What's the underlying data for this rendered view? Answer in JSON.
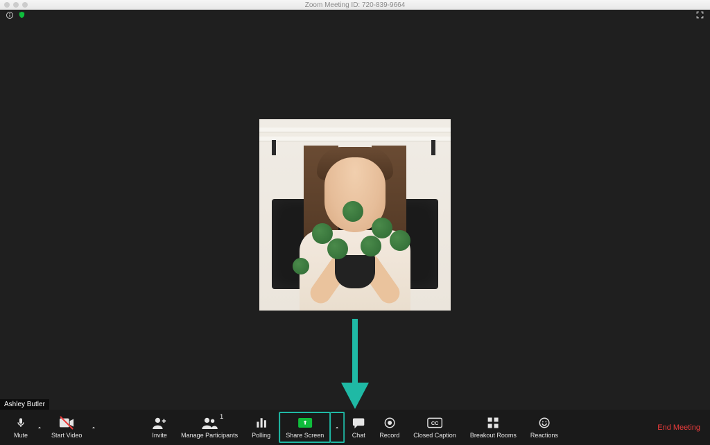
{
  "titlebar": {
    "title": "Zoom Meeting ID: 720-839-9664"
  },
  "participant": {
    "name": "Ashley Butler"
  },
  "participants_count": "1",
  "toolbar": {
    "mute": "Mute",
    "start_video": "Start Video",
    "invite": "Invite",
    "manage_participants": "Manage Participants",
    "polling": "Polling",
    "share_screen": "Share Screen",
    "chat": "Chat",
    "record": "Record",
    "closed_caption": "Closed Caption",
    "breakout_rooms": "Breakout Rooms",
    "reactions": "Reactions"
  },
  "end_meeting": "End Meeting",
  "annotation": {
    "arrow_color": "#1fb9a5"
  }
}
